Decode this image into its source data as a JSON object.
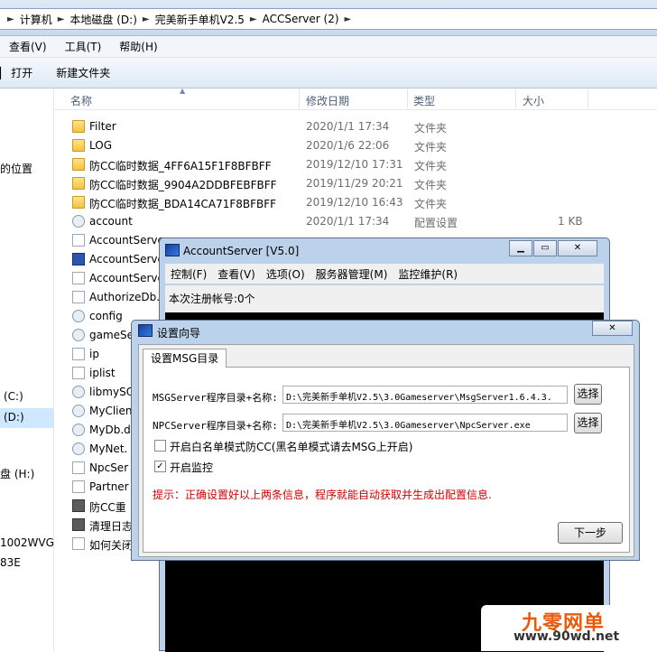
{
  "breadcrumbs": [
    "计算机",
    "本地磁盘 (D:)",
    "完美新手单机V2.5",
    "ACCServer (2)"
  ],
  "menu": [
    "查看(V)",
    "工具(T)",
    "帮助(H)"
  ],
  "commands": {
    "open": "打开",
    "new_folder": "新建文件夹"
  },
  "nav": {
    "places": "的位置",
    "c_drive": "(C:)",
    "d_drive": "(D:)",
    "h_drive": "盘 (H:)",
    "host": "1002WVG",
    "host2": "83E"
  },
  "columns": {
    "name": "名称",
    "date": "修改日期",
    "type": "类型",
    "size": "大小"
  },
  "files": [
    {
      "name": "Filter",
      "date": "2020/1/1 17:34",
      "type": "文件夹",
      "size": "",
      "icon": "folder"
    },
    {
      "name": "LOG",
      "date": "2020/1/6 22:06",
      "type": "文件夹",
      "size": "",
      "icon": "folder"
    },
    {
      "name": "防CC临时数据_4FF6A15F1F8BFBFF",
      "date": "2019/12/10 17:31",
      "type": "文件夹",
      "size": "",
      "icon": "folder"
    },
    {
      "name": "防CC临时数据_9904A2DDBFEBFBFF",
      "date": "2019/11/29 20:21",
      "type": "文件夹",
      "size": "",
      "icon": "folder"
    },
    {
      "name": "防CC临时数据_BDA14CA71F8BFBFF",
      "date": "2019/12/10 16:43",
      "type": "文件夹",
      "size": "",
      "icon": "folder"
    },
    {
      "name": "account",
      "date": "2020/1/1 17:34",
      "type": "配置设置",
      "size": "1 KB",
      "icon": "gear"
    },
    {
      "name": "AccountServe",
      "date": "",
      "type": "",
      "size": "",
      "icon": "doc"
    },
    {
      "name": "AccountServer",
      "date": "",
      "type": "",
      "size": "",
      "icon": "exe"
    },
    {
      "name": "AccountServe",
      "date": "",
      "type": "",
      "size": "",
      "icon": "doc"
    },
    {
      "name": "AuthorizeDb.",
      "date": "",
      "type": "",
      "size": "",
      "icon": "doc"
    },
    {
      "name": "config",
      "date": "",
      "type": "",
      "size": "",
      "icon": "gear"
    },
    {
      "name": "gameSe",
      "date": "",
      "type": "",
      "size": "",
      "icon": "gear"
    },
    {
      "name": "ip",
      "date": "",
      "type": "",
      "size": "",
      "icon": "doc"
    },
    {
      "name": "iplist",
      "date": "",
      "type": "",
      "size": "",
      "icon": "doc"
    },
    {
      "name": "libmySQ",
      "date": "",
      "type": "",
      "size": "",
      "icon": "gear"
    },
    {
      "name": "MyClien",
      "date": "",
      "type": "",
      "size": "",
      "icon": "gear"
    },
    {
      "name": "MyDb.d",
      "date": "",
      "type": "",
      "size": "",
      "icon": "gear"
    },
    {
      "name": "MyNet.",
      "date": "",
      "type": "",
      "size": "",
      "icon": "gear"
    },
    {
      "name": "NpcSer",
      "date": "",
      "type": "",
      "size": "",
      "icon": "doc"
    },
    {
      "name": "Partner",
      "date": "",
      "type": "",
      "size": "",
      "icon": "doc"
    },
    {
      "name": "防CC重",
      "date": "",
      "type": "",
      "size": "",
      "icon": "bat"
    },
    {
      "name": "清理日志",
      "date": "",
      "type": "",
      "size": "",
      "icon": "bat"
    },
    {
      "name": "如何关闭",
      "date": "",
      "type": "",
      "size": "",
      "icon": "doc"
    }
  ],
  "acc_window": {
    "title": "AccountServer [V5.0]",
    "menu": [
      "控制(F)",
      "查看(V)",
      "选项(O)",
      "服务器管理(M)",
      "监控维护(R)"
    ],
    "status": "本次注册帐号:0个"
  },
  "wizard": {
    "title": "设置向导",
    "tab": "设置MSG目录",
    "msg_label": "MSGServer程序目录+名称:",
    "msg_path": "D:\\完美新手单机V2.5\\3.0Gameserver\\MsgServer1.6.4.3.",
    "npc_label": "NPCServer程序目录+名称:",
    "npc_path": "D:\\完美新手单机V2.5\\3.0Gameserver\\NpcServer.exe",
    "browse_label": "选择",
    "whitelist_label": "开启白名单模式防CC(黑名单模式请去MSG上开启)",
    "monitor_label": "开启监控",
    "whitelist_checked": false,
    "monitor_checked": true,
    "hint": "提示：正确设置好以上两条信息，程序就能自动获取并生成出配置信息.",
    "next_label": "下一步",
    "hint_color": "#d40000"
  },
  "watermark": {
    "line1": "九零网单",
    "line2": "www.90wd.net"
  }
}
